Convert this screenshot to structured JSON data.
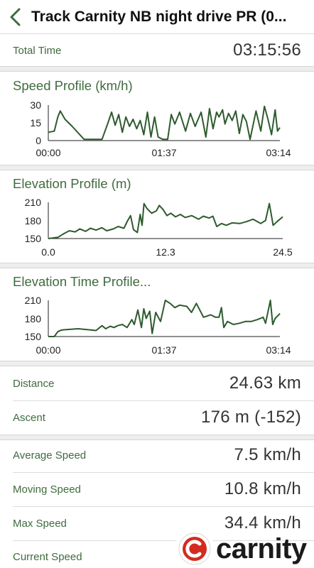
{
  "header": {
    "title": "Track Carnity NB night drive PR (0..."
  },
  "summary": {
    "total_time_label": "Total Time",
    "total_time_value": "03:15:56"
  },
  "speed_profile": {
    "title": "Speed Profile (km/h)",
    "y_ticks": [
      "30",
      "15",
      "0"
    ],
    "x_ticks": [
      "00:00",
      "01:37",
      "03:14"
    ],
    "chart_data": {
      "type": "line",
      "x_range": [
        0,
        194
      ],
      "ylim": [
        0,
        30
      ],
      "x": [
        0,
        5,
        8,
        10,
        14,
        20,
        30,
        45,
        50,
        53,
        56,
        59,
        62,
        65,
        68,
        71,
        74,
        77,
        80,
        83,
        86,
        89,
        92,
        96,
        100,
        103,
        106,
        110,
        115,
        119,
        123,
        128,
        132,
        135,
        138,
        141,
        143,
        146,
        148,
        151,
        154,
        157,
        160,
        163,
        166,
        169,
        174,
        178,
        181,
        184,
        187,
        190,
        192,
        194
      ],
      "y": [
        7,
        8,
        20,
        25,
        18,
        12,
        1,
        1,
        15,
        24,
        13,
        22,
        7,
        20,
        12,
        18,
        10,
        17,
        5,
        24,
        3,
        20,
        3,
        1,
        1,
        22,
        14,
        24,
        8,
        23,
        12,
        24,
        3,
        27,
        10,
        24,
        20,
        26,
        14,
        23,
        17,
        25,
        6,
        22,
        16,
        1,
        25,
        8,
        29,
        18,
        5,
        26,
        8,
        11
      ]
    }
  },
  "elevation_profile": {
    "title": "Elevation Profile (m)",
    "y_ticks": [
      "210",
      "180",
      "150"
    ],
    "x_ticks": [
      "0.0",
      "12.3",
      "24.5"
    ],
    "chart_data": {
      "type": "line",
      "x_range": [
        0,
        24.5
      ],
      "ylim": [
        150,
        210
      ],
      "x": [
        0,
        1,
        1.6,
        2.2,
        2.8,
        3.3,
        3.9,
        4.4,
        5,
        5.6,
        6.1,
        6.8,
        7.3,
        7.9,
        8.3,
        8.6,
        8.9,
        9.3,
        9.6,
        9.8,
        10,
        10.3,
        10.8,
        11.3,
        11.6,
        12,
        12.4,
        12.8,
        13.3,
        13.8,
        14.3,
        15,
        15.7,
        16.2,
        16.8,
        17.2,
        17.6,
        18.1,
        18.6,
        19.2,
        20,
        20.7,
        21.4,
        22.2,
        22.7,
        23.1,
        23.5,
        23.9,
        24.5
      ],
      "y": [
        150,
        152,
        158,
        163,
        161,
        166,
        162,
        167,
        164,
        168,
        163,
        166,
        170,
        167,
        180,
        188,
        165,
        160,
        190,
        172,
        208,
        200,
        192,
        196,
        205,
        198,
        188,
        192,
        186,
        190,
        185,
        188,
        182,
        187,
        184,
        187,
        170,
        175,
        172,
        176,
        175,
        178,
        182,
        175,
        180,
        208,
        172,
        178,
        186
      ]
    }
  },
  "elevation_time_profile": {
    "title": "Elevation Time Profile...",
    "y_ticks": [
      "210",
      "180",
      "150"
    ],
    "x_ticks": [
      "00:00",
      "01:37",
      "03:14"
    ],
    "chart_data": {
      "type": "line",
      "x_range": [
        0,
        194
      ],
      "ylim": [
        150,
        210
      ],
      "x": [
        0,
        5,
        8,
        10,
        12,
        25,
        40,
        45,
        48,
        52,
        55,
        58,
        62,
        66,
        70,
        72,
        75,
        78,
        80,
        82,
        85,
        87,
        90,
        94,
        98,
        102,
        106,
        110,
        116,
        120,
        124,
        130,
        136,
        140,
        143,
        145,
        147,
        150,
        155,
        160,
        165,
        170,
        175,
        180,
        182,
        186,
        188,
        190,
        194
      ],
      "y": [
        150,
        150,
        158,
        160,
        161,
        163,
        160,
        168,
        163,
        167,
        165,
        168,
        170,
        165,
        178,
        170,
        194,
        165,
        196,
        180,
        192,
        155,
        190,
        175,
        210,
        205,
        198,
        202,
        200,
        190,
        205,
        182,
        186,
        182,
        182,
        198,
        165,
        175,
        170,
        172,
        175,
        175,
        178,
        182,
        172,
        210,
        170,
        180,
        188
      ]
    }
  },
  "stats": {
    "distance_label": "Distance",
    "distance_value": "24.63 km",
    "ascent_label": "Ascent",
    "ascent_value": "176 m (-152)"
  },
  "speeds": {
    "average_label": "Average Speed",
    "average_value": "7.5 km/h",
    "moving_label": "Moving Speed",
    "moving_value": "10.8 km/h",
    "max_label": "Max Speed",
    "max_value": "34.4 km/h",
    "current_label": "Current Speed"
  },
  "logo": {
    "text": "carnity"
  },
  "colors": {
    "accent": "#3f6b3f",
    "line": "#2e5b2e",
    "logo_red": "#d42b1e",
    "separator": "#eeeeee"
  }
}
